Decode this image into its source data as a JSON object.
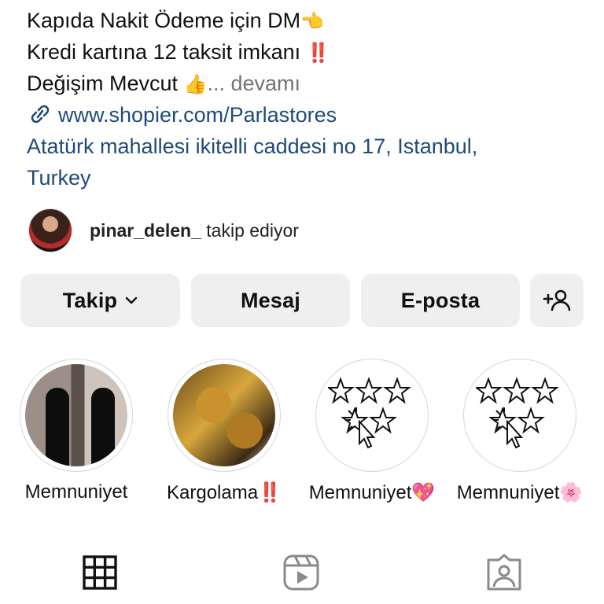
{
  "bio": {
    "line1": "Kapıda Nakit Ödeme için DM",
    "line1_emoji": "👈",
    "line2": "Kredi kartına 12 taksit imkanı",
    "line2_emoji": "‼️",
    "line3": "Değişim Mevcut",
    "line3_emoji": "👍",
    "more": "... devamı",
    "link": "www.shopier.com/Parlastores",
    "address_line1": "Atatürk mahallesi ikitelli caddesi no 17, Istanbul,",
    "address_line2": "Turkey"
  },
  "follower": {
    "username": "pinar_delen_",
    "text": "takip ediyor"
  },
  "actions": {
    "follow_label": "Takip",
    "message_label": "Mesaj",
    "email_label": "E-posta"
  },
  "highlights": [
    {
      "label": "Memnuniyet",
      "emoji": ""
    },
    {
      "label": "Kargolama",
      "emoji": "‼️"
    },
    {
      "label": "Memnuniyet",
      "emoji": "💖"
    },
    {
      "label": "Memnuniyet",
      "emoji": "🌸"
    }
  ],
  "icons": {
    "link": "link-icon",
    "chevron": "chevron-down-icon",
    "add_person": "add-person-icon",
    "grid": "grid-icon",
    "reels": "reels-icon",
    "tagged": "tagged-icon"
  },
  "colors": {
    "link": "#1f4a7a",
    "button_bg": "#efefef",
    "muted": "#737373"
  }
}
